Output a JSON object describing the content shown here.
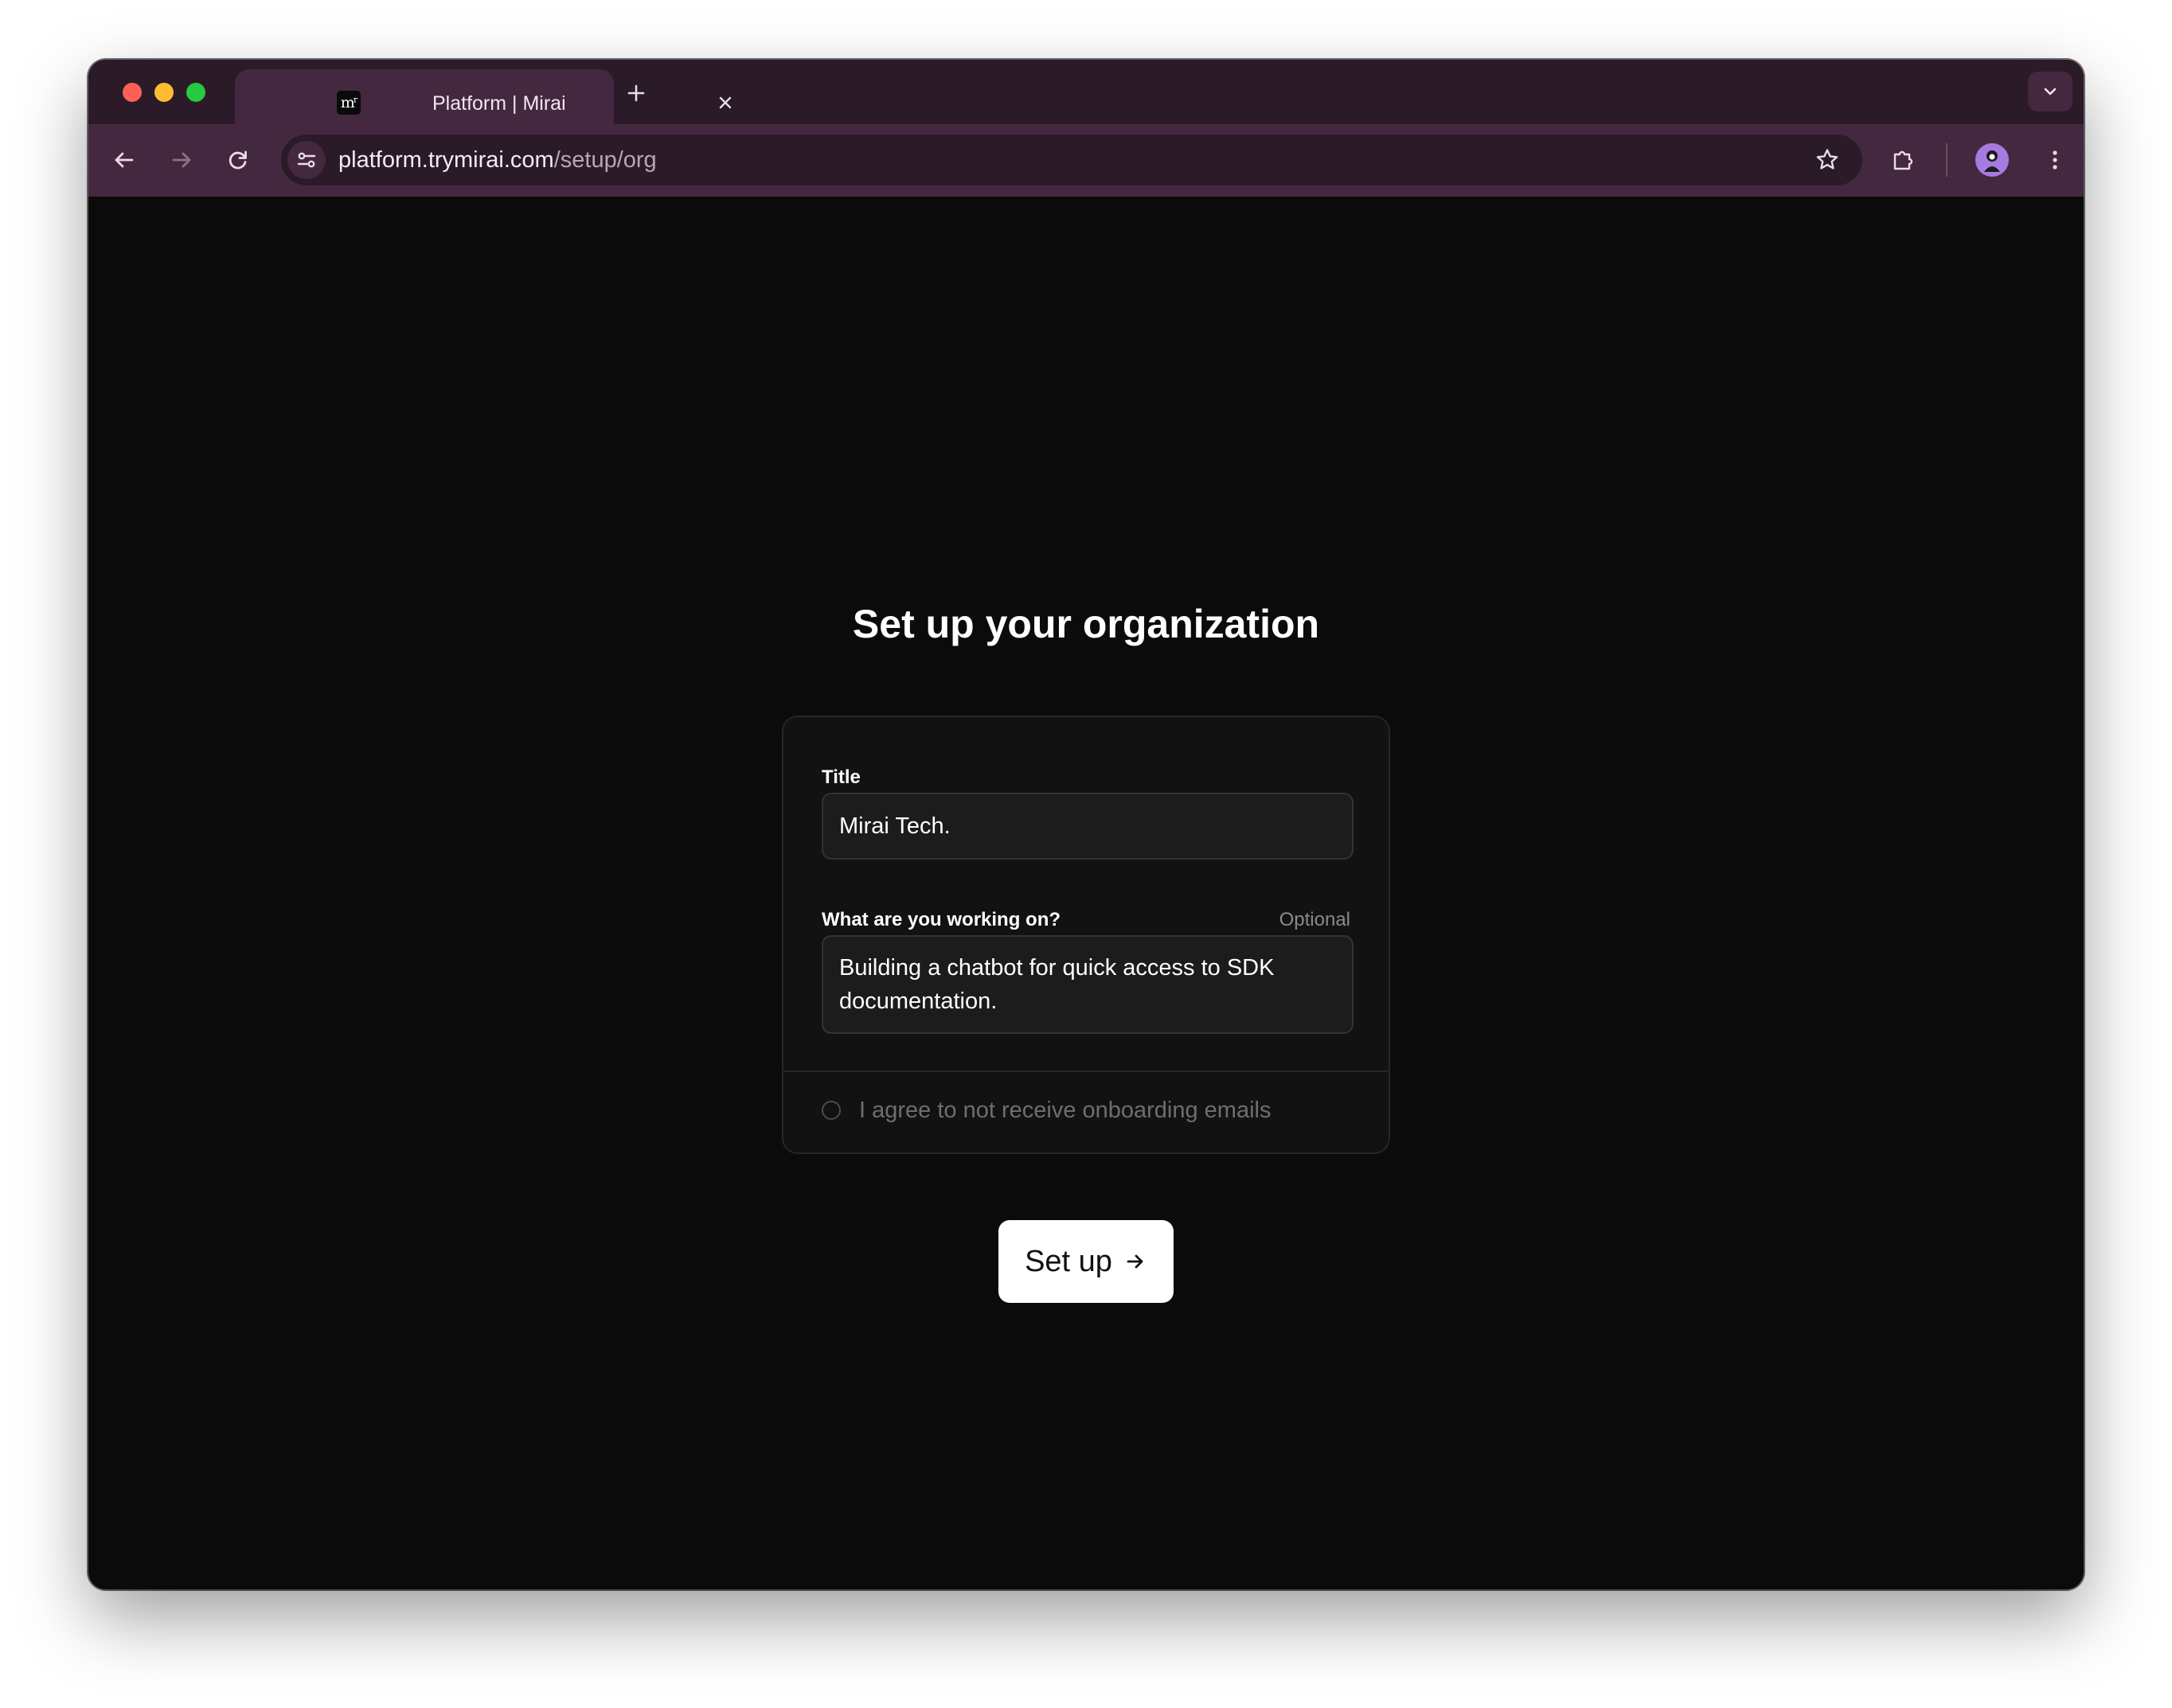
{
  "browser": {
    "tab": {
      "favicon_text": "mʳ",
      "title": "Platform | Mirai"
    },
    "url": {
      "host": "platform.trymirai.com",
      "path": "/setup/org"
    },
    "icons": {
      "back": "arrow-left-icon",
      "forward": "arrow-right-icon",
      "reload": "reload-icon",
      "site_info": "tune-icon",
      "bookmark": "star-icon",
      "extensions": "puzzle-icon",
      "menu": "kebab-menu-icon",
      "tab_search": "chevron-down-icon",
      "new_tab": "plus-icon",
      "close_tab": "close-icon"
    },
    "colors": {
      "frame": "#2b1a28",
      "toolbar": "#44283f",
      "avatar": "#a77ae0"
    }
  },
  "page": {
    "heading": "Set up your organization",
    "title_field": {
      "label": "Title",
      "value": "Mirai Tech."
    },
    "working_on_field": {
      "label": "What are you working on?",
      "optional_label": "Optional",
      "value": "Building a chatbot for quick access to SDK documentation."
    },
    "consent": {
      "label": "I agree to not receive onboarding emails",
      "checked": false
    },
    "submit": {
      "label": "Set up",
      "icon": "arrow-right-icon"
    },
    "colors": {
      "background": "#0b0b0b",
      "card": "#121212",
      "button": "#ffffff"
    }
  }
}
